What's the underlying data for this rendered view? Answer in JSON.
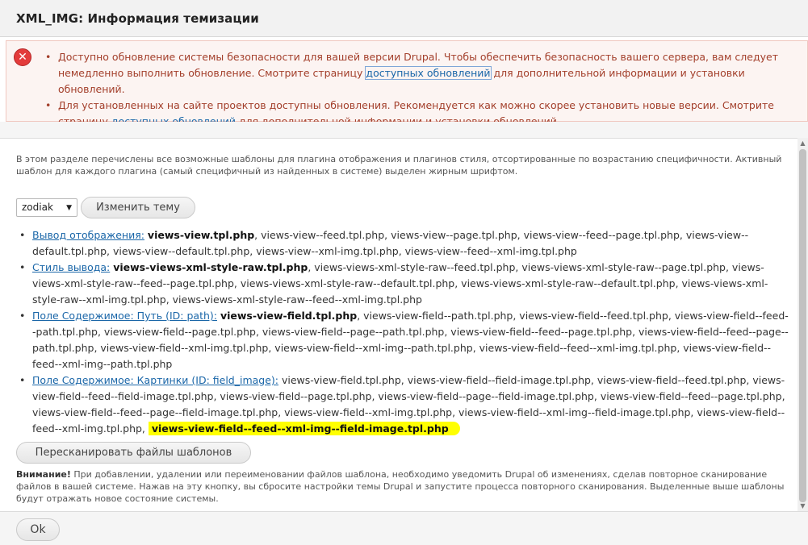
{
  "dialog": {
    "title": "XML_IMG: Информация темизации"
  },
  "messages": {
    "items": [
      {
        "before": "Доступно обновление системы безопасности для вашей версии Drupal. Чтобы обеспечить безопасность вашего сервера, вам следует немедленно выполнить обновление. Смотрите страницу ",
        "link": "доступных обновлений",
        "after": " для дополнительной информации и установки обновлений."
      },
      {
        "before": "Для установленных на сайте проектов доступны обновления. Рекомендуется как можно скорее установить новые версии. Смотрите страницу ",
        "link": "доступных обновлений",
        "after": " для дополнительной информации и установки обновлений."
      }
    ]
  },
  "description": "В этом разделе перечислены все возможные шаблоны для плагина отображения и плагинов стиля, отсортированные по возрастанию специфичности. Активный шаблон для каждого плагина (самый специфичный из найденных в системе) выделен жирным шрифтом.",
  "theme_select": {
    "value": "zodiak"
  },
  "buttons": {
    "change_theme": "Изменить тему",
    "rescan": "Пересканировать файлы шаблонов",
    "ok": "Ok"
  },
  "templates": [
    {
      "label": "Вывод отображения:",
      "active": "views-view.tpl.php",
      "rest": ", views-view--feed.tpl.php, views-view--page.tpl.php, views-view--feed--page.tpl.php, views-view--default.tpl.php, views-view--default.tpl.php, views-view--xml-img.tpl.php, views-view--feed--xml-img.tpl.php"
    },
    {
      "label": "Стиль вывода:",
      "active": "views-views-xml-style-raw.tpl.php",
      "rest": ", views-views-xml-style-raw--feed.tpl.php, views-views-xml-style-raw--page.tpl.php, views-views-xml-style-raw--feed--page.tpl.php, views-views-xml-style-raw--default.tpl.php, views-views-xml-style-raw--default.tpl.php, views-views-xml-style-raw--xml-img.tpl.php, views-views-xml-style-raw--feed--xml-img.tpl.php"
    },
    {
      "label": "Поле Содержимое: Путь (ID: path):",
      "active": "views-view-field.tpl.php",
      "rest": ", views-view-field--path.tpl.php, views-view-field--feed.tpl.php, views-view-field--feed--path.tpl.php, views-view-field--page.tpl.php, views-view-field--page--path.tpl.php, views-view-field--feed--page.tpl.php, views-view-field--feed--page--path.tpl.php, views-view-field--xml-img.tpl.php, views-view-field--xml-img--path.tpl.php, views-view-field--feed--xml-img.tpl.php, views-view-field--feed--xml-img--path.tpl.php"
    },
    {
      "label": "Поле Содержимое: Картинки (ID: field_image):",
      "rest": " views-view-field.tpl.php, views-view-field--field-image.tpl.php, views-view-field--feed.tpl.php, views-view-field--feed--field-image.tpl.php, views-view-field--page.tpl.php, views-view-field--page--field-image.tpl.php, views-view-field--feed--page.tpl.php, views-view-field--feed--page--field-image.tpl.php, views-view-field--xml-img.tpl.php, views-view-field--xml-img--field-image.tpl.php, views-view-field--feed--xml-img.tpl.php, ",
      "highlighted": "views-view-field--feed--xml-img--field-image.tpl.php"
    }
  ],
  "warning": {
    "bold": "Внимание!",
    "text": " При добавлении, удалении или переименовании файлов шаблона, необходимо уведомить Drupal об изменениях, сделав повторное сканирование файлов в вашей системе. Нажав на эту кнопку, вы сбросите настройки темы Drupal и запустите процесса повторного сканирования. Выделенные выше шаблоны будут отражать новое состояние системы."
  },
  "colors": {
    "link": "#1a66a8",
    "error_text": "#a33f2b",
    "error_bg": "#fcf4f2",
    "highlight": "#ffff00"
  },
  "icons": {
    "error": "error-x-icon",
    "select_caret": "caret-down-icon"
  }
}
